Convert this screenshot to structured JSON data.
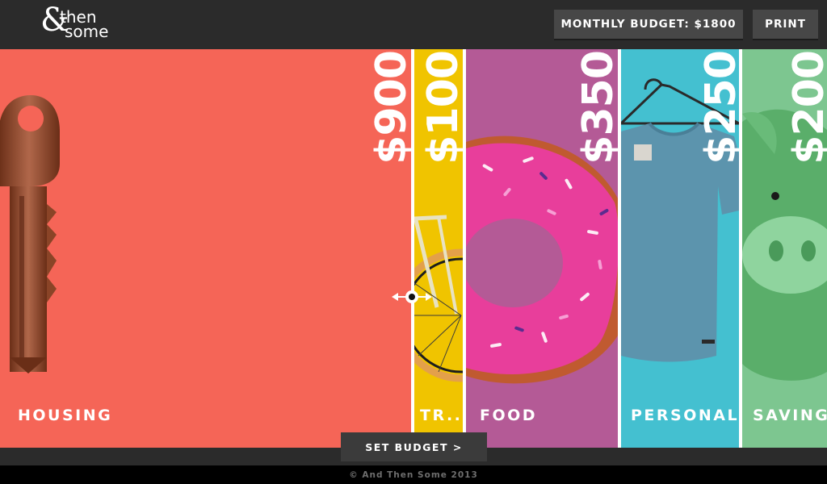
{
  "header": {
    "logo_amp": "&",
    "logo_line1": "then",
    "logo_line2": "some",
    "budget_label": "MONTHLY BUDGET: $1800",
    "print_label": "PRINT"
  },
  "colors": {
    "housing": "#f56557",
    "transport": "#f0c400",
    "food": "#b45a96",
    "personal": "#44c0d0",
    "saving": "#7dc690"
  },
  "categories": [
    {
      "key": "housing",
      "label": "HOUSING",
      "amount": "$900",
      "icon": "key-icon"
    },
    {
      "key": "transport",
      "label": "TR..",
      "amount": "$100",
      "icon": "bicycle-icon"
    },
    {
      "key": "food",
      "label": "FOOD",
      "amount": "$350",
      "icon": "donut-icon"
    },
    {
      "key": "personal",
      "label": "PERSONAL",
      "amount": "$250",
      "icon": "tshirt-icon"
    },
    {
      "key": "saving",
      "label": "SAVING",
      "amount": "$200",
      "icon": "piggy-bank-icon"
    }
  ],
  "actions": {
    "set_budget": "SET BUDGET >"
  },
  "footer": {
    "copyright": "© And Then Some 2013"
  }
}
